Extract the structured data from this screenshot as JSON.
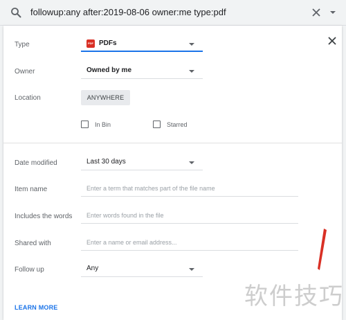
{
  "search": {
    "query": "followup:any after:2019-08-06 owner:me type:pdf"
  },
  "colors": {
    "accent": "#1a73e8",
    "pdf_red": "#d93025",
    "watermark_gray": "#bdbdbd"
  },
  "icons": {
    "search": "search-icon",
    "clear": "close-icon",
    "options": "chevron-down-icon",
    "close_panel": "close-icon",
    "pdf": "pdf-file-icon"
  },
  "filters": {
    "type": {
      "label": "Type",
      "value": "PDFs",
      "pdf_badge": "PDF"
    },
    "owner": {
      "label": "Owner",
      "value": "Owned by me"
    },
    "location": {
      "label": "Location",
      "chip": "ANYWHERE",
      "in_bin": "In Bin",
      "starred": "Starred"
    },
    "date_modified": {
      "label": "Date modified",
      "value": "Last 30 days"
    },
    "item_name": {
      "label": "Item name",
      "placeholder": "Enter a term that matches part of the file name"
    },
    "includes_words": {
      "label": "Includes the words",
      "placeholder": "Enter words found in the file"
    },
    "shared_with": {
      "label": "Shared with",
      "placeholder": "Enter a name or email address..."
    },
    "follow_up": {
      "label": "Follow up",
      "value": "Any"
    }
  },
  "learn_more": "LEARN MORE",
  "watermark": "软件技巧"
}
